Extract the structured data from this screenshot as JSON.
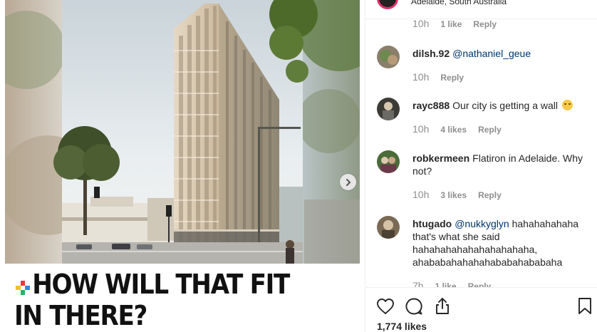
{
  "post": {
    "location": "Adelaide, South Australia",
    "headline": "HOW WILL THAT FIT IN THERE?",
    "likes": "1,774 likes"
  },
  "top_partial": {
    "time": "10h",
    "likes": "1 like",
    "reply": "Reply"
  },
  "comments": [
    {
      "username": "dilsh.92",
      "mention": "@nathaniel_geue",
      "text": "",
      "time": "10h",
      "likes": "",
      "reply": "Reply"
    },
    {
      "username": "rayc888",
      "mention": "",
      "text": "Our city is getting a wall",
      "emoji": "rolling-on-floor-laughing-emoji",
      "time": "10h",
      "likes": "4 likes",
      "reply": "Reply"
    },
    {
      "username": "robkermeen",
      "mention": "",
      "text": "Flatiron in Adelaide. Why not?",
      "time": "10h",
      "likes": "3 likes",
      "reply": "Reply"
    },
    {
      "username": "htugado",
      "mention": "@nukkyglyn",
      "text": "hahahahahaha that's what she said hahahahahahahahahahaha, ahababahahahahababahababaha",
      "time": "7h",
      "likes": "1 like",
      "reply": "Reply"
    }
  ],
  "icons": {
    "heart": "heart-icon",
    "comment": "comment-icon",
    "share": "share-icon",
    "save": "bookmark-icon",
    "next": "chevron-right-icon"
  },
  "colors": {
    "mention": "#003569",
    "meta": "#8e8e8e",
    "text": "#262626",
    "logo_red": "#e23b3b",
    "logo_green": "#27b36b",
    "logo_blue": "#3a86d8",
    "logo_yellow": "#f2c12e"
  }
}
